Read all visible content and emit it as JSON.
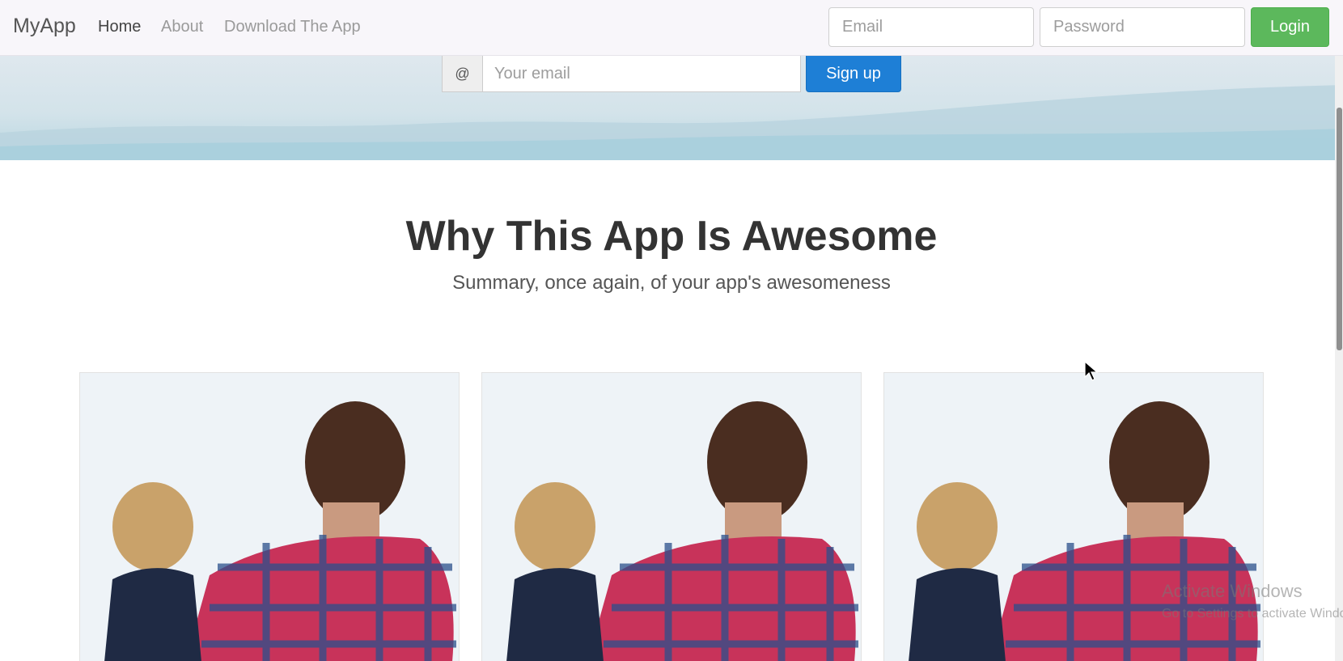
{
  "navbar": {
    "brand": "MyApp",
    "links": [
      "Home",
      "About",
      "Download The App"
    ],
    "active_link": "Home",
    "email_placeholder": "Email",
    "password_placeholder": "Password",
    "login_label": "Login"
  },
  "hero": {
    "addon_symbol": "@",
    "email_placeholder": "Your email",
    "signup_label": "Sign up"
  },
  "features": {
    "title": "Why This App Is Awesome",
    "subtitle": "Summary, once again, of your app's awesomeness",
    "cards": [
      {
        "image": "father-and-child-photo"
      },
      {
        "image": "father-and-child-photo"
      },
      {
        "image": "father-and-child-photo"
      }
    ]
  },
  "watermark": {
    "title": "Activate Windows",
    "subtitle": "Go to Settings to activate Windows."
  },
  "colors": {
    "login": "#5cb85c",
    "signup": "#1e7fd6",
    "navbar_bg": "#f8f6fa"
  }
}
